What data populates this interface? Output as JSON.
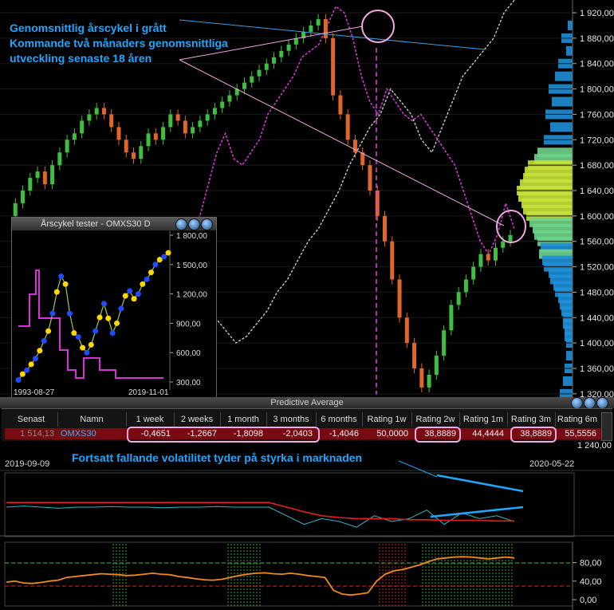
{
  "annotations": {
    "line1": "Genomsnittlig årscykel i grått",
    "line2": "Kommande två månaders genomsnittliga",
    "line3": "utveckling senaste 18 åren",
    "volatility": "Fortsatt fallande volatilitet tyder på styrka i marknaden"
  },
  "colors": {
    "background": "#000000",
    "annotation": "#1fa6ff",
    "up_candle": "#3fbf3f",
    "down_candle": "#e0662a",
    "forecast": "#d633d6",
    "cycle": "#c8c8c8",
    "highlight": "#f2a9df"
  },
  "chart_data": [
    {
      "type": "candlestick",
      "name": "main-price-chart",
      "ylim": [
        1240,
        1940
      ],
      "yticks": [
        "1 920,00",
        "1 880,00",
        "1 840,00",
        "1 800,00",
        "1 760,00",
        "1 720,00",
        "1 680,00",
        "1 640,00",
        "1 600,00",
        "1 560,00",
        "1 520,00",
        "1 480,00",
        "1 440,00",
        "1 400,00",
        "1 360,00",
        "1 320,00",
        "1 240,00"
      ],
      "x_start_label": "2019-09-09",
      "x_end_label": "2020-05-22",
      "price_close": [
        1600,
        1620,
        1640,
        1660,
        1670,
        1650,
        1680,
        1700,
        1720,
        1730,
        1750,
        1760,
        1770,
        1760,
        1740,
        1720,
        1700,
        1690,
        1710,
        1730,
        1720,
        1740,
        1760,
        1750,
        1730,
        1740,
        1750,
        1760,
        1770,
        1780,
        1790,
        1800,
        1810,
        1820,
        1830,
        1840,
        1850,
        1860,
        1870,
        1880,
        1890,
        1900,
        1910,
        1880,
        1790,
        1760,
        1720,
        1700,
        1680,
        1640,
        1600,
        1560,
        1500,
        1440,
        1400,
        1360,
        1330,
        1350,
        1380,
        1420,
        1460,
        1480,
        1500,
        1520,
        1540,
        1530,
        1550,
        1560,
        1570
      ],
      "forecast_series": [
        1560,
        1600,
        1650,
        1700,
        1730,
        1690,
        1680,
        1700,
        1720,
        1760,
        1780,
        1800,
        1820,
        1850,
        1860,
        1870,
        1900,
        1930,
        1920,
        1880,
        1820,
        1780,
        1760,
        1800,
        1780,
        1760,
        1750,
        1760,
        1740,
        1720,
        1700,
        1680,
        1640,
        1600,
        1560,
        1540,
        1570,
        1620,
        1580
      ],
      "cycle_series": [
        1440,
        1420,
        1400,
        1410,
        1430,
        1450,
        1480,
        1500,
        1530,
        1560,
        1580,
        1610,
        1640,
        1680,
        1710,
        1740,
        1760,
        1800,
        1780,
        1760,
        1720,
        1700,
        1740,
        1780,
        1820,
        1840,
        1860,
        1880,
        1920,
        1940
      ]
    },
    {
      "type": "line",
      "name": "volatility",
      "series": [
        {
          "values": [
            0.5,
            0.52,
            0.5,
            0.48,
            0.5,
            0.5,
            0.51,
            0.5,
            0.5,
            0.49,
            0.5,
            0.5,
            0.51,
            0.5,
            0.5,
            0.5,
            0.35,
            0.2,
            0.3,
            0.25,
            0.15,
            0.35,
            0.25,
            0.3,
            0.45,
            0.2,
            0.4,
            0.3,
            0.35,
            0.25
          ]
        },
        {
          "values": [
            0.58,
            0.58,
            0.58,
            0.58,
            0.58,
            0.58,
            0.58,
            0.58,
            0.58,
            0.58,
            0.58,
            0.58,
            0.58,
            0.58,
            0.58,
            0.58,
            0.5,
            0.42,
            0.35,
            0.32,
            0.3,
            0.3,
            0.3,
            0.28,
            0.28,
            0.27,
            0.27,
            0.27,
            0.26,
            0.26
          ]
        }
      ]
    },
    {
      "type": "line",
      "name": "oscillator",
      "yticks": [
        "80,00",
        "40,00",
        "0,00"
      ],
      "ylim": [
        0,
        100
      ],
      "values": [
        38,
        40,
        36,
        35,
        37,
        40,
        42,
        48,
        50,
        52,
        54,
        56,
        55,
        54,
        52,
        53,
        55,
        57,
        55,
        54,
        50,
        48,
        45,
        43,
        42,
        44,
        48,
        52,
        55,
        57,
        58,
        56,
        55,
        57,
        55,
        52,
        50,
        48,
        20,
        12,
        10,
        12,
        15,
        40,
        55,
        62,
        65,
        70,
        75,
        82,
        88,
        90,
        92,
        93,
        92,
        90,
        88,
        90,
        92,
        90
      ]
    },
    {
      "type": "line",
      "name": "inset-annual-cycle",
      "title": "Årscykel tester - OMXS30  D",
      "yticks": [
        "1 800,00",
        "1 500,00",
        "1 200,00",
        "900,00",
        "600,00",
        "300,00"
      ],
      "x_start_label": "1993-08-27",
      "x_end_label": "2019-11-01",
      "ylim": [
        300,
        1800
      ],
      "values": [
        320,
        380,
        420,
        480,
        540,
        620,
        720,
        820,
        1000,
        1220,
        1380,
        1300,
        1000,
        800,
        760,
        650,
        600,
        680,
        820,
        960,
        1100,
        950,
        800,
        900,
        1050,
        1180,
        1230,
        1150,
        1200,
        1300,
        1350,
        1420,
        1500,
        1550,
        1580,
        1620
      ]
    }
  ],
  "predictive_average": {
    "title": "Predictive Average",
    "headers": [
      "Senast",
      "Namn",
      "1 week",
      "2 weeks",
      "1 month",
      "3 months",
      "6 months",
      "Rating 1w",
      "Rating 2w",
      "Rating 1m",
      "Rating 3m",
      "Rating 6m"
    ],
    "row": {
      "senast": "1 514,13",
      "namn": "OMXS30",
      "w1": "-0,4651",
      "w2": "-1,2667",
      "m1": "-1,8098",
      "m3": "-2,0403",
      "m6": "-1,4046",
      "r1w": "50,0000",
      "r2w": "38,8889",
      "r1m": "44,4444",
      "r3m": "38,8889",
      "r6m": "55,5556"
    },
    "partial_axis": "1 240,00"
  }
}
